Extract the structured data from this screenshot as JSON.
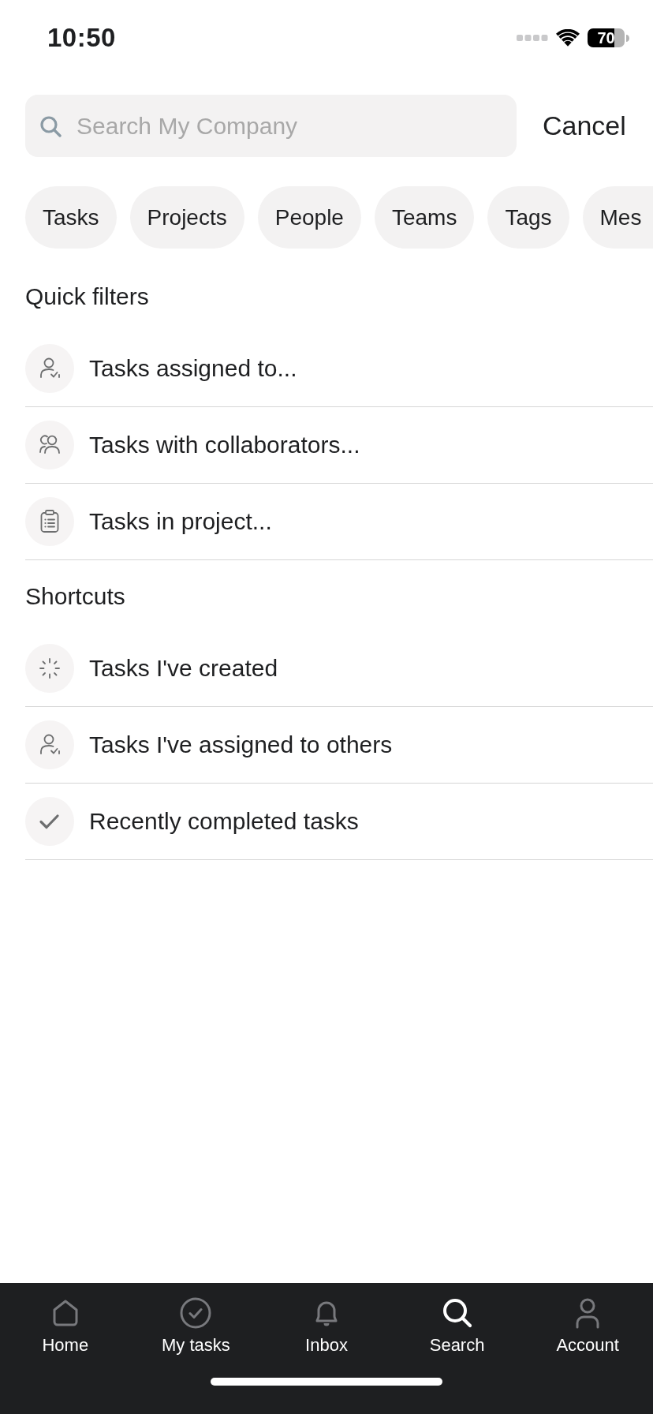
{
  "status_bar": {
    "time": "10:50",
    "battery": "70"
  },
  "search": {
    "placeholder": "Search My Company",
    "cancel": "Cancel"
  },
  "chips": [
    {
      "label": "Tasks"
    },
    {
      "label": "Projects"
    },
    {
      "label": "People"
    },
    {
      "label": "Teams"
    },
    {
      "label": "Tags"
    },
    {
      "label": "Mes"
    }
  ],
  "sections": [
    {
      "title": "Quick filters",
      "items": [
        {
          "kind": "assignee",
          "label": "Tasks assigned to..."
        },
        {
          "kind": "collaborators",
          "label": "Tasks with collaborators..."
        },
        {
          "kind": "project",
          "label": "Tasks in project..."
        }
      ]
    },
    {
      "title": "Shortcuts",
      "items": [
        {
          "kind": "created",
          "label": "Tasks I've created"
        },
        {
          "kind": "assignee",
          "label": "Tasks I've assigned to others"
        },
        {
          "kind": "completed",
          "label": "Recently completed tasks"
        }
      ]
    }
  ],
  "tabs": [
    {
      "kind": "home",
      "label": "Home",
      "selected": false
    },
    {
      "kind": "tasks",
      "label": "My tasks",
      "selected": false
    },
    {
      "kind": "inbox",
      "label": "Inbox",
      "selected": false
    },
    {
      "kind": "search",
      "label": "Search",
      "selected": true
    },
    {
      "kind": "account",
      "label": "Account",
      "selected": false
    }
  ]
}
